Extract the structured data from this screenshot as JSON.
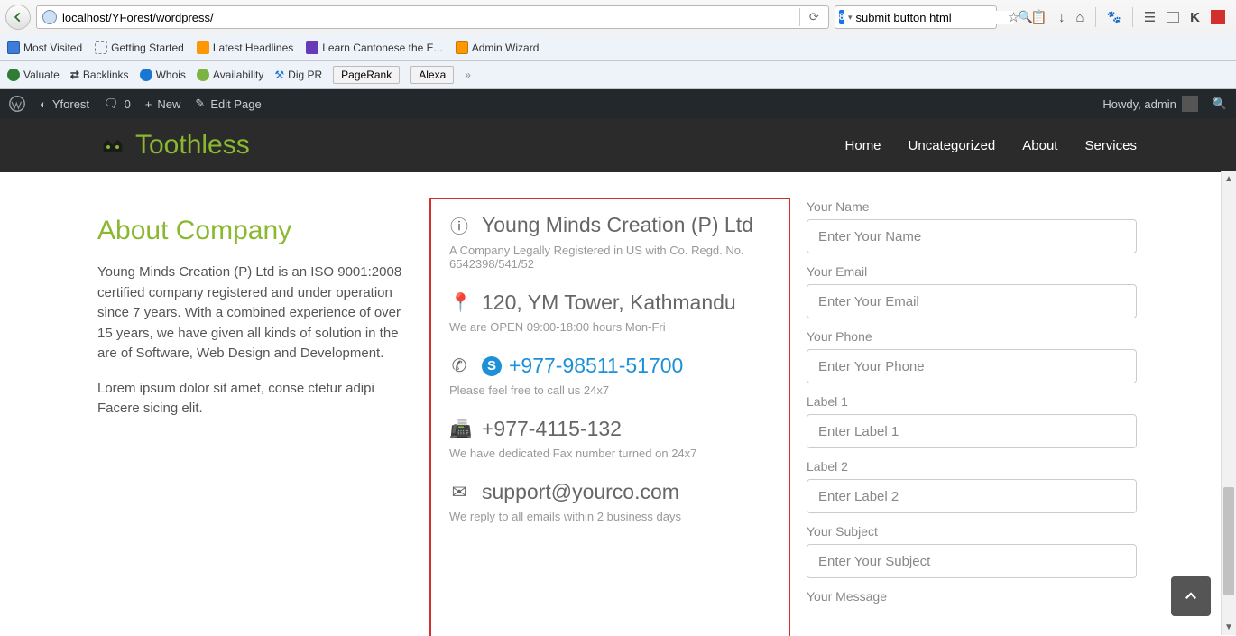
{
  "browser": {
    "url": "localhost/YForest/wordpress/",
    "search_value": "submit button html",
    "bookmarks": [
      "Most Visited",
      "Getting Started",
      "Latest Headlines",
      "Learn Cantonese the E...",
      "Admin Wizard"
    ],
    "seo_bar": {
      "items": [
        "Valuate",
        "Backlinks",
        "Whois",
        "Availability",
        "Dig PR"
      ],
      "buttons": [
        "PageRank",
        "Alexa"
      ]
    }
  },
  "wp": {
    "site": "Yforest",
    "comments": "0",
    "new": "New",
    "edit": "Edit Page",
    "howdy": "Howdy, admin"
  },
  "theme": {
    "brand": "Toothless",
    "nav": [
      "Home",
      "Uncategorized",
      "About",
      "Services"
    ]
  },
  "about": {
    "title": "About Company",
    "p1": "Young Minds Creation (P) Ltd is an ISO 9001:2008 certified company registered and under operation since 7 years. With a combined experience of over 15 years, we have given all kinds of solution in the are of Software, Web Design and Development.",
    "p2": "Lorem ipsum dolor sit amet, conse ctetur adipi Facere sicing elit."
  },
  "contact": {
    "company": "Young Minds Creation (P) Ltd",
    "company_sub": "A Company Legally Registered in US with Co. Regd. No. 6542398/541/52",
    "address": "120, YM Tower, Kathmandu",
    "address_sub": "We are OPEN 09:00-18:00 hours Mon-Fri",
    "phone": "+977-98511-51700",
    "phone_sub": "Please feel free to call us 24x7",
    "fax": "+977-4115-132",
    "fax_sub": "We have dedicated Fax number turned on 24x7",
    "email": "support@yourco.com",
    "email_sub": "We reply to all emails within 2 business days"
  },
  "form": {
    "fields": [
      {
        "label": "Your Name",
        "placeholder": "Enter Your Name"
      },
      {
        "label": "Your Email",
        "placeholder": "Enter Your Email"
      },
      {
        "label": "Your Phone",
        "placeholder": "Enter Your Phone"
      },
      {
        "label": "Label 1",
        "placeholder": "Enter Label 1"
      },
      {
        "label": "Label 2",
        "placeholder": "Enter Label 2"
      },
      {
        "label": "Your Subject",
        "placeholder": "Enter Your Subject"
      },
      {
        "label": "Your Message",
        "placeholder": ""
      }
    ]
  }
}
